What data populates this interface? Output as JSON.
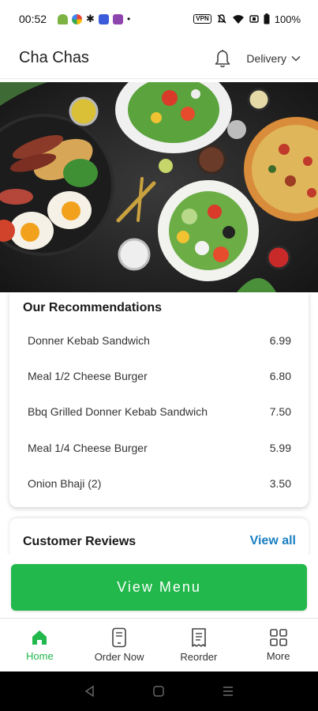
{
  "status_bar": {
    "time": "00:52",
    "battery": "100%",
    "vpn_label": "VPN"
  },
  "header": {
    "title": "Cha Chas",
    "delivery_label": "Delivery"
  },
  "recommendations": {
    "title": "Our Recommendations",
    "items": [
      {
        "name": "Donner Kebab Sandwich",
        "price": "6.99"
      },
      {
        "name": "Meal 1/2 Cheese Burger",
        "price": "6.80"
      },
      {
        "name": "Bbq Grilled Donner Kebab Sandwich",
        "price": "7.50"
      },
      {
        "name": "Meal 1/4 Cheese Burger",
        "price": "5.99"
      },
      {
        "name": "Onion Bhaji (2)",
        "price": "3.50"
      }
    ]
  },
  "reviews": {
    "title": "Customer Reviews",
    "view_all": "View all"
  },
  "cta": {
    "label": "View Menu"
  },
  "bottom_nav": {
    "items": [
      {
        "label": "Home",
        "icon": "home-icon",
        "active": true
      },
      {
        "label": "Order Now",
        "icon": "phone-order-icon",
        "active": false
      },
      {
        "label": "Reorder",
        "icon": "receipt-icon",
        "active": false
      },
      {
        "label": "More",
        "icon": "grid-icon",
        "active": false
      }
    ]
  },
  "colors": {
    "accent_green": "#22b84c",
    "link_blue": "#1a7fc1"
  }
}
